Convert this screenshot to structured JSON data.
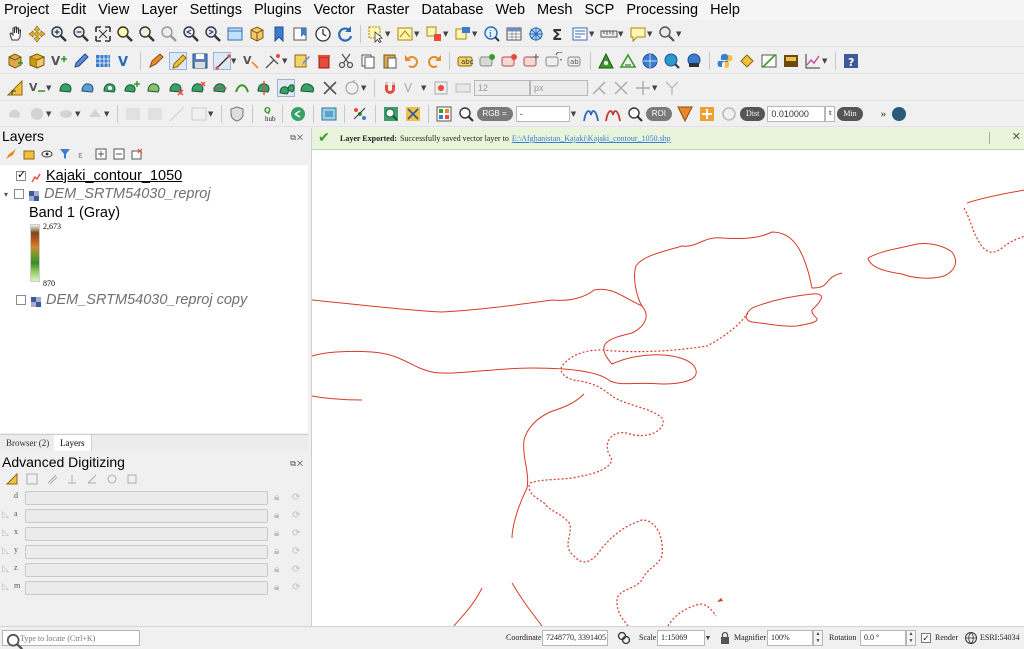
{
  "menu": [
    "Project",
    "Edit",
    "View",
    "Layer",
    "Settings",
    "Plugins",
    "Vector",
    "Raster",
    "Database",
    "Web",
    "Mesh",
    "SCP",
    "Processing",
    "Help"
  ],
  "toolbar3": {
    "font_size": "12",
    "font_unit": "px"
  },
  "scp_toolbar": {
    "hub_label": "hub",
    "rgb_label": "RGB =",
    "rgb_value": "-",
    "roi_label": "ROI",
    "dist_label": "Dist",
    "dist_value": "0.010000",
    "min_label": "Min"
  },
  "layers_panel": {
    "title": "Layers",
    "layers": [
      {
        "name": "Kajaki_contour_1050",
        "checked": true
      },
      {
        "name": "DEM_SRTM54030_reproj",
        "checked": false
      },
      {
        "name": "DEM_SRTM54030_reproj copy",
        "checked": false
      }
    ],
    "band_label": "Band 1 (Gray)",
    "ramp_max": "2,673",
    "ramp_min": "870"
  },
  "panel_tabs": {
    "browser": "Browser (2)",
    "layers": "Layers"
  },
  "adv_digitizing": {
    "title": "Advanced Digitizing",
    "fields": [
      "d",
      "a",
      "x",
      "y",
      "z",
      "m"
    ]
  },
  "message": {
    "title": "Layer Exported:",
    "body": "Successfully saved vector layer to",
    "link": "E:\\Afghanistan_Kajaki\\Kajaki_contour_1050.shp"
  },
  "statusbar": {
    "locate_placeholder": "Type to locate (Ctrl+K)",
    "coordinate_label": "Coordinate",
    "coordinate": "7248770, 3391405",
    "scale_label": "Scale",
    "scale": "1:15069",
    "magnifier_label": "Magnifier",
    "magnifier": "100%",
    "rotation_label": "Rotation",
    "rotation": "0.0 °",
    "render_label": "Render",
    "crs": "ESRI:54034"
  },
  "colors": {
    "contour": "#d93a2b",
    "message_bg": "#e9f4dd",
    "link": "#3a7dd0"
  }
}
